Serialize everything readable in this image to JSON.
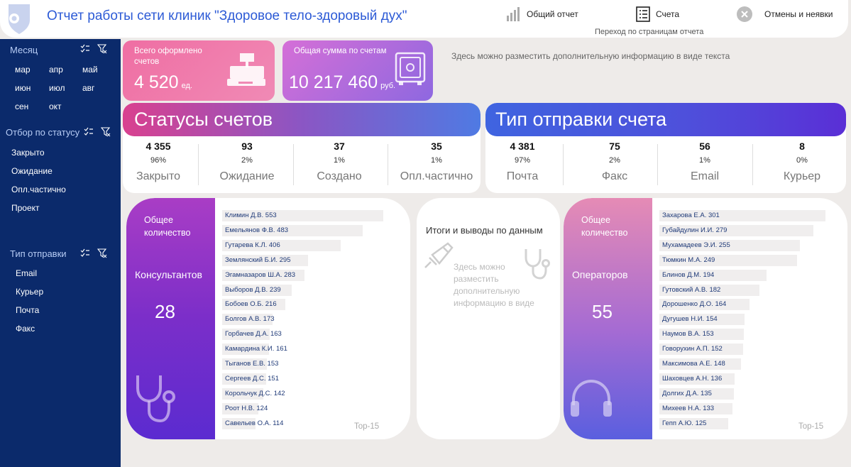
{
  "header": {
    "title": "Отчет работы сети клиник \"Здоровое тело-здоровый дух\"",
    "nav": [
      {
        "label": "Общий отчет"
      },
      {
        "label": "Счета"
      },
      {
        "label": "Отмены и неявки"
      }
    ],
    "nav_hint": "Переход по страницам отчета"
  },
  "sidebar": {
    "month_title": "Месяц",
    "months": [
      "мар",
      "апр",
      "май",
      "июн",
      "июл",
      "авг",
      "сен",
      "окт"
    ],
    "status_title": "Отбор по статусу",
    "statuses": [
      "Закрыто",
      "Ожидание",
      "Опл.частично",
      "Проект"
    ],
    "send_title": "Тип отправки",
    "send_types": [
      "Email",
      "Курьер",
      "Почта",
      "Факс"
    ]
  },
  "kpi": {
    "invoices": {
      "label": "Всего оформлено счетов",
      "value": "4 520",
      "unit": "ед."
    },
    "sum": {
      "label": "Общая сумма по счетам",
      "value": "10 217 460",
      "unit": "руб."
    },
    "info": "Здесь можно разместить дополнительную информацию в виде текста"
  },
  "statuses": {
    "title": "Статусы счетов",
    "items": [
      {
        "value": "4 355",
        "pct": "96%",
        "label": "Закрыто"
      },
      {
        "value": "93",
        "pct": "2%",
        "label": "Ожидание"
      },
      {
        "value": "37",
        "pct": "1%",
        "label": "Создано"
      },
      {
        "value": "35",
        "pct": "1%",
        "label": "Опл.частично"
      }
    ]
  },
  "send_types": {
    "title": "Тип отправки счета",
    "items": [
      {
        "value": "4 381",
        "pct": "97%",
        "label": "Почта"
      },
      {
        "value": "75",
        "pct": "2%",
        "label": "Факс"
      },
      {
        "value": "56",
        "pct": "1%",
        "label": "Email"
      },
      {
        "value": "8",
        "pct": "0%",
        "label": "Курьер"
      }
    ]
  },
  "consultants": {
    "label": "Общее количество",
    "role": "Консультантов",
    "count": "28",
    "top": "Top-15",
    "items": [
      {
        "name": "Климин Д.В.",
        "value": 553
      },
      {
        "name": "Емельянов Ф.В.",
        "value": 483
      },
      {
        "name": "Гутарева К.Л.",
        "value": 406
      },
      {
        "name": "Землянский Б.И.",
        "value": 295
      },
      {
        "name": "Эгамназаров Ш.А.",
        "value": 283
      },
      {
        "name": "Выборов Д.В.",
        "value": 239
      },
      {
        "name": "Бобоев О.Б.",
        "value": 216
      },
      {
        "name": "Болгов А.В.",
        "value": 173
      },
      {
        "name": "Горбачев Д.А.",
        "value": 163
      },
      {
        "name": "Камардина К.И.",
        "value": 161
      },
      {
        "name": "Тыганов Е.В.",
        "value": 153
      },
      {
        "name": "Сергеев Д.С.",
        "value": 151
      },
      {
        "name": "Корольчук Д.С.",
        "value": 142
      },
      {
        "name": "Роот Н.В.",
        "value": 124
      },
      {
        "name": "Савельев О.А.",
        "value": 114
      }
    ]
  },
  "summary": {
    "title": "Итоги и выводы по данным",
    "text": "Здесь можно разместить дополнительную информацию в виде"
  },
  "operators": {
    "label": "Общее количество",
    "role": "Операторов",
    "count": "55",
    "top": "Top-15",
    "items": [
      {
        "name": "Захарова Е.А.",
        "value": 301
      },
      {
        "name": "Губайдулин И.И.",
        "value": 279
      },
      {
        "name": "Мухамадеев Э.И.",
        "value": 255
      },
      {
        "name": "Тюмкин М.А.",
        "value": 249
      },
      {
        "name": "Блинов Д.М.",
        "value": 194
      },
      {
        "name": "Гутовский А.В.",
        "value": 182
      },
      {
        "name": "Дорошенко Д.О.",
        "value": 164
      },
      {
        "name": "Дугушев Н.И.",
        "value": 154
      },
      {
        "name": "Наумов В.А.",
        "value": 153
      },
      {
        "name": "Говорухин А.П.",
        "value": 152
      },
      {
        "name": "Максимова А.Е.",
        "value": 148
      },
      {
        "name": "Шаховцев А.Н.",
        "value": 136
      },
      {
        "name": "Долгих Д.А.",
        "value": 135
      },
      {
        "name": "Михеев Н.А.",
        "value": 133
      },
      {
        "name": "Гепп А.Ю.",
        "value": 125
      }
    ]
  },
  "colors": {
    "sidebar": "#0b2a6b",
    "title": "#2d5bd6",
    "status_head_start": "#d9418f",
    "status_head_end": "#4f7ae3",
    "send_head_start": "#3f64e0",
    "send_head_end": "#5a2fd6"
  }
}
